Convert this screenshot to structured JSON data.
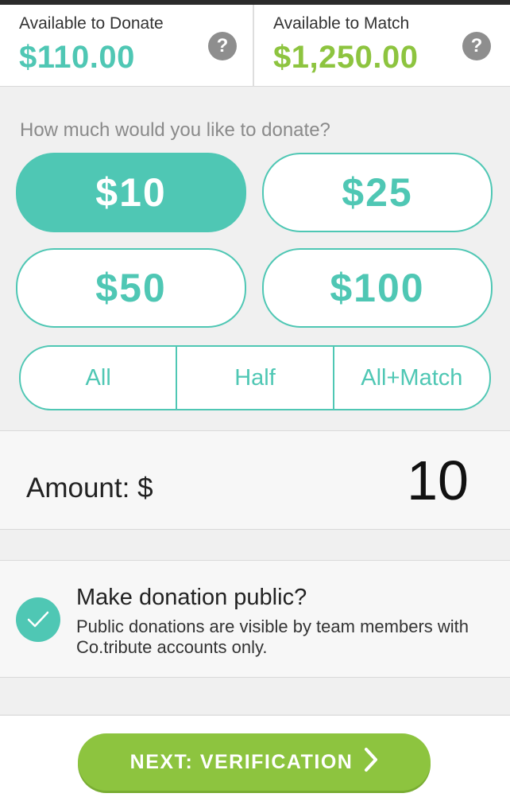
{
  "balances": {
    "donate": {
      "label": "Available to Donate",
      "value": "$110.00",
      "help": "?"
    },
    "match": {
      "label": "Available to Match",
      "value": "$1,250.00",
      "help": "?"
    }
  },
  "question": "How much would you like to donate?",
  "amount_options": [
    {
      "label": "$10",
      "selected": true
    },
    {
      "label": "$25",
      "selected": false
    },
    {
      "label": "$50",
      "selected": false
    },
    {
      "label": "$100",
      "selected": false
    }
  ],
  "quick_options": [
    "All",
    "Half",
    "All+Match"
  ],
  "amount": {
    "label": "Amount: $",
    "value": "10"
  },
  "public": {
    "checked": true,
    "title": "Make donation public?",
    "description": "Public donations are visible by team members with Co.tribute accounts only."
  },
  "next_button": {
    "label": "NEXT: VERIFICATION"
  },
  "colors": {
    "teal": "#4fc7b4",
    "green": "#8dc43f",
    "help_grey": "#8e8e8e"
  },
  "icons": {
    "help": "question-circle-icon",
    "check": "check-icon",
    "next": "chevron-right-icon"
  }
}
